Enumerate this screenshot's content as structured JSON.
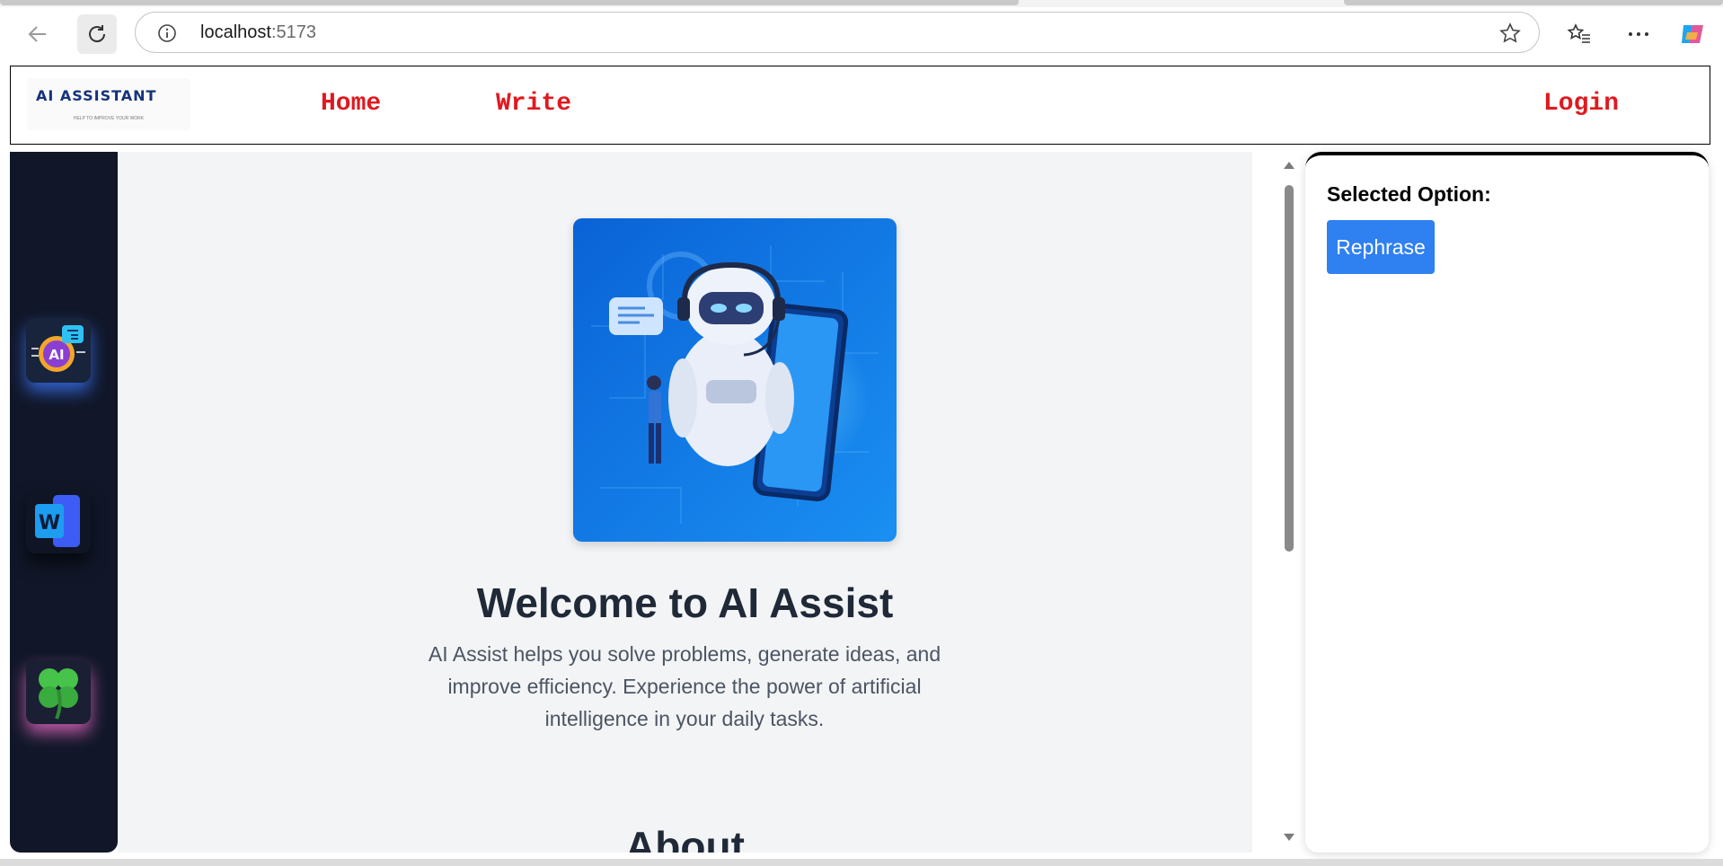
{
  "browser": {
    "url_host": "localhost",
    "url_port": ":5173"
  },
  "navbar": {
    "logo_text": "AI ASSISTANT",
    "logo_tagline": "HELP TO IMPROVE YOUR WORK",
    "links": [
      "Home",
      "Write",
      "Login"
    ]
  },
  "sidebar": {
    "icons": [
      "ai-chip-icon",
      "word-document-icon",
      "four-leaf-clover-icon"
    ]
  },
  "main": {
    "welcome_title": "Welcome to AI Assist",
    "description": "AI Assist helps you solve problems, generate ideas, and improve efficiency. Experience the power of artificial intelligence in your daily tasks.",
    "section_heading": "About"
  },
  "right_panel": {
    "selected_label": "Selected Option:",
    "option_button": "Rephrase"
  }
}
